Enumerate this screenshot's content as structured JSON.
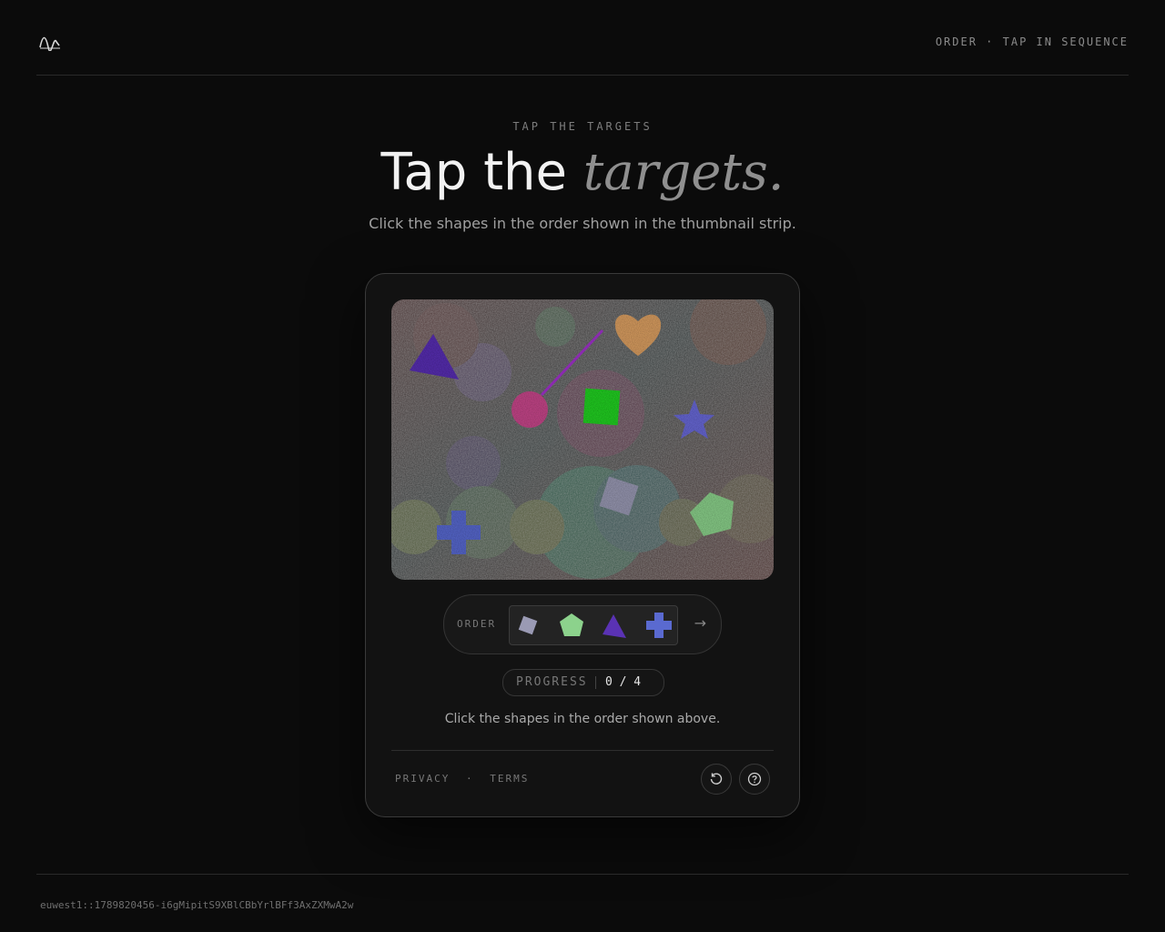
{
  "header": {
    "logo_icon": "wave-logo-icon",
    "nav_text": "ORDER · TAP IN SEQUENCE"
  },
  "hero": {
    "eyebrow": "TAP THE TARGETS",
    "title_plain": "Tap the ",
    "title_emphasis": "targets.",
    "subtitle": "Click the shapes in the order shown in the thumbnail strip."
  },
  "challenge": {
    "shapes": [
      "triangle",
      "heart",
      "circle",
      "square",
      "star",
      "square",
      "cross",
      "pentagon"
    ],
    "order_label": "ORDER",
    "order_sequence": [
      "square",
      "pentagon",
      "triangle",
      "cross"
    ],
    "next_icon": "arrow-right-icon",
    "progress_label": "PROGRESS",
    "progress_current": 0,
    "progress_total": 4,
    "progress_text": "0 / 4",
    "instruction": "Click the shapes in the order shown above."
  },
  "card_footer": {
    "privacy": "PRIVACY",
    "separator": "·",
    "terms": "TERMS",
    "reload_icon": "reload-icon",
    "help_icon": "help-icon"
  },
  "footer": {
    "request_id": "euwest1::1789820456-i6gMipitS9XBlCBbYrlBFf3AxZXMwA2w"
  },
  "colors": {
    "background": "#0b0b0b",
    "card_border": "#3a3a3a",
    "triangle": "#5a32b4",
    "heart": "#dca064",
    "circle": "#c84a8c",
    "square_green": "#28d228",
    "star": "#6a6ad8",
    "square_grey": "#9a9ab4",
    "cross": "#5a6ad0",
    "pentagon": "#8cd28c"
  }
}
